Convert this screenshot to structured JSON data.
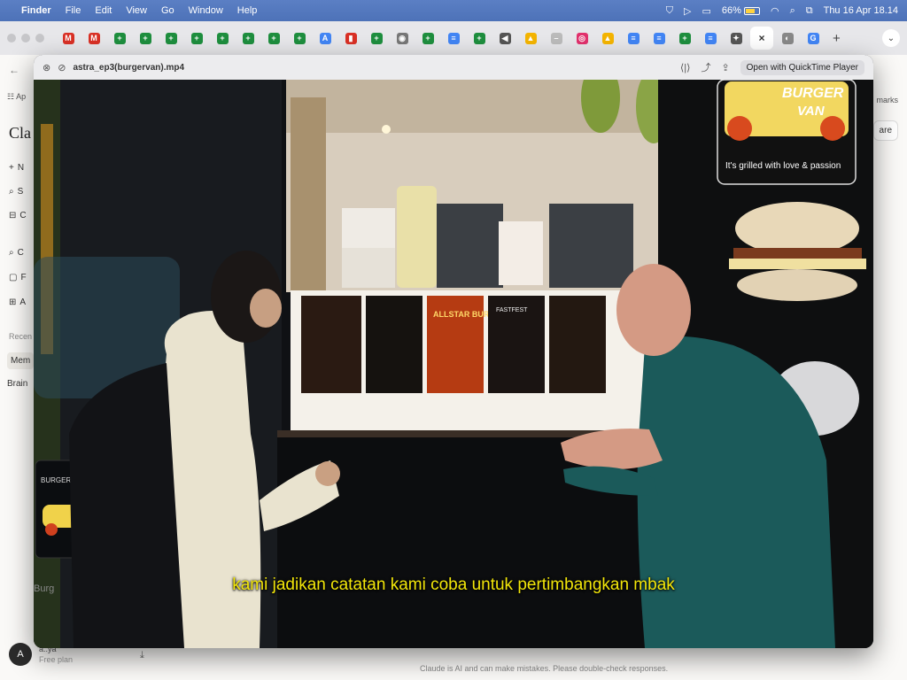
{
  "menubar": {
    "app": "Finder",
    "items": [
      "File",
      "Edit",
      "View",
      "Go",
      "Window",
      "Help"
    ],
    "battery": "66%",
    "datetime": "Thu 16 Apr 18.14"
  },
  "browser": {
    "tabs": [
      {
        "icon": "gmail-icon",
        "color": "#d93025",
        "glyph": "M"
      },
      {
        "icon": "gmail-icon",
        "color": "#d93025",
        "glyph": "M"
      },
      {
        "icon": "sheets-icon",
        "color": "#1e8e3e",
        "glyph": "+"
      },
      {
        "icon": "sheets-icon",
        "color": "#1e8e3e",
        "glyph": "+"
      },
      {
        "icon": "sheets-icon",
        "color": "#1e8e3e",
        "glyph": "+"
      },
      {
        "icon": "sheets-icon",
        "color": "#1e8e3e",
        "glyph": "+"
      },
      {
        "icon": "sheets-icon",
        "color": "#1e8e3e",
        "glyph": "+"
      },
      {
        "icon": "sheets-icon",
        "color": "#1e8e3e",
        "glyph": "+"
      },
      {
        "icon": "sheets-icon",
        "color": "#1e8e3e",
        "glyph": "+"
      },
      {
        "icon": "sheets-icon",
        "color": "#1e8e3e",
        "glyph": "+"
      },
      {
        "icon": "analytics-icon",
        "color": "#4285f4",
        "glyph": "A"
      },
      {
        "icon": "bookmark-icon",
        "color": "#d93025",
        "glyph": "▮"
      },
      {
        "icon": "sheets-icon",
        "color": "#1e8e3e",
        "glyph": "+"
      },
      {
        "icon": "shield-icon",
        "color": "#777777",
        "glyph": "◉"
      },
      {
        "icon": "sheets-icon",
        "color": "#1e8e3e",
        "glyph": "+"
      },
      {
        "icon": "docs-icon",
        "color": "#4285f4",
        "glyph": "≡"
      },
      {
        "icon": "sheets-icon",
        "color": "#1e8e3e",
        "glyph": "+"
      },
      {
        "icon": "audio-icon",
        "color": "#555555",
        "glyph": "◀"
      },
      {
        "icon": "drive-icon",
        "color": "#f4b400",
        "glyph": "▲"
      },
      {
        "icon": "blank-icon",
        "color": "#bbbbbb",
        "glyph": "–"
      },
      {
        "icon": "instagram-icon",
        "color": "#e1306c",
        "glyph": "◎"
      },
      {
        "icon": "drive-icon",
        "color": "#f4b400",
        "glyph": "▲"
      },
      {
        "icon": "docs-icon",
        "color": "#4285f4",
        "glyph": "≡"
      },
      {
        "icon": "docs-icon",
        "color": "#4285f4",
        "glyph": "≡"
      },
      {
        "icon": "sheets-icon",
        "color": "#1e8e3e",
        "glyph": "+"
      },
      {
        "icon": "docs-icon",
        "color": "#4285f4",
        "glyph": "≡"
      },
      {
        "icon": "claude-icon",
        "color": "#555555",
        "glyph": "✦"
      }
    ],
    "active_tab_glyph": "×",
    "after_tabs": [
      {
        "icon": "extension-icon",
        "color": "#888888",
        "glyph": "◐"
      },
      {
        "icon": "google-icon",
        "color": "#4285f4",
        "glyph": "G"
      }
    ],
    "new_tab": "+",
    "tab_menu": "⌄"
  },
  "page": {
    "back": "←",
    "apps": "☷ Ap",
    "title": "Cla",
    "rows": [
      {
        "icon": "+",
        "label": "N"
      },
      {
        "icon": "⌕",
        "label": "S"
      },
      {
        "icon": "⊟",
        "label": "C"
      },
      {
        "icon": "⌕",
        "label": "C"
      },
      {
        "icon": "▢",
        "label": "F"
      },
      {
        "icon": "⊞",
        "label": "A"
      }
    ],
    "recents_label": "Recen",
    "recent_items": [
      "Mem",
      "Brain"
    ],
    "right_stub_top": "marks",
    "right_stub_button": "are",
    "user": {
      "initial": "A",
      "name": "a..ya",
      "plan": "Free plan"
    },
    "download": "⤓",
    "disclaimer": "Claude is AI and can make mistakes. Please double-check responses."
  },
  "quicklook": {
    "close": "⊗",
    "expand": "⊘",
    "filename": "astra_ep3(burgervan).mp4",
    "tools": [
      "⟨|⟩",
      "⤴",
      "⇪"
    ],
    "open_button": "Open with QuickTime Player",
    "subtitle": "kami jadikan catatan kami coba untuk pertimbangkan mbak",
    "sign_brand_top": "BURGER",
    "sign_brand_bottom": "VAN",
    "sign_tagline": "It's grilled with love & passion",
    "menu_poster_title": "ALLSTAR BURGER",
    "menu_poster_heading": "FASTFEST",
    "small_sign": "BURGER VAN",
    "side_text": "Burg"
  }
}
